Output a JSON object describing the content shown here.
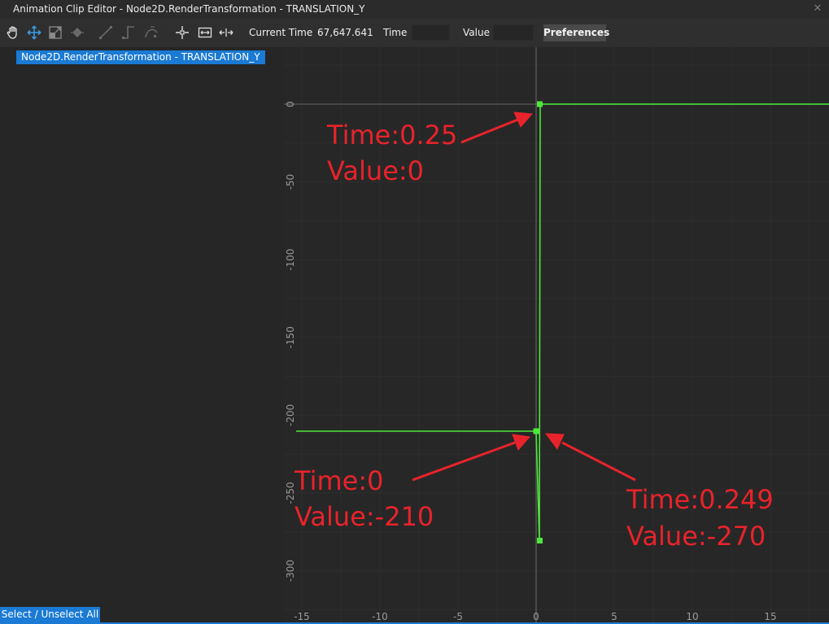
{
  "window": {
    "title": "Animation Clip Editor - Node2D.RenderTransformation - TRANSLATION_Y",
    "close_icon": "close-icon"
  },
  "toolbar": {
    "icons": [
      "hand-pan-icon",
      "move-arrows-icon",
      "scale-box-icon",
      "keyframe-diamond-icon",
      "linear-tangent-icon",
      "step-tangent-icon",
      "bezier-tangent-icon",
      "center-view-icon",
      "fit-view-icon",
      "fit-horizontal-icon"
    ],
    "current_time_label": "Current Time",
    "current_time_value": "67,647.641",
    "time_label": "Time",
    "time_value": "",
    "value_label": "Value",
    "value_value": "",
    "preferences_label": "Preferences"
  },
  "tracks": [
    {
      "label": "Node2D.RenderTransformation - TRANSLATION_Y",
      "selected": true
    }
  ],
  "select_unselect_label": "Select / Unselect All",
  "graph": {
    "curve_color": "#4de83a",
    "annotation_color": "#e8232b",
    "x_ticks": [
      "-15",
      "-10",
      "-5",
      "0",
      "5",
      "10",
      "15"
    ],
    "y_ticks": [
      "0",
      "-50",
      "-100",
      "-150",
      "-200",
      "-250",
      "-300"
    ],
    "keyframes": [
      {
        "time": 0.25,
        "value": 0
      },
      {
        "time": 0,
        "value": -210
      },
      {
        "time": 0.249,
        "value": -270
      }
    ],
    "annotations": [
      {
        "line1": "Time:0.25",
        "line2": "Value:0"
      },
      {
        "line1": "Time:0",
        "line2": "Value:-210"
      },
      {
        "line1": "Time:0.249",
        "line2": "Value:-270"
      }
    ]
  }
}
